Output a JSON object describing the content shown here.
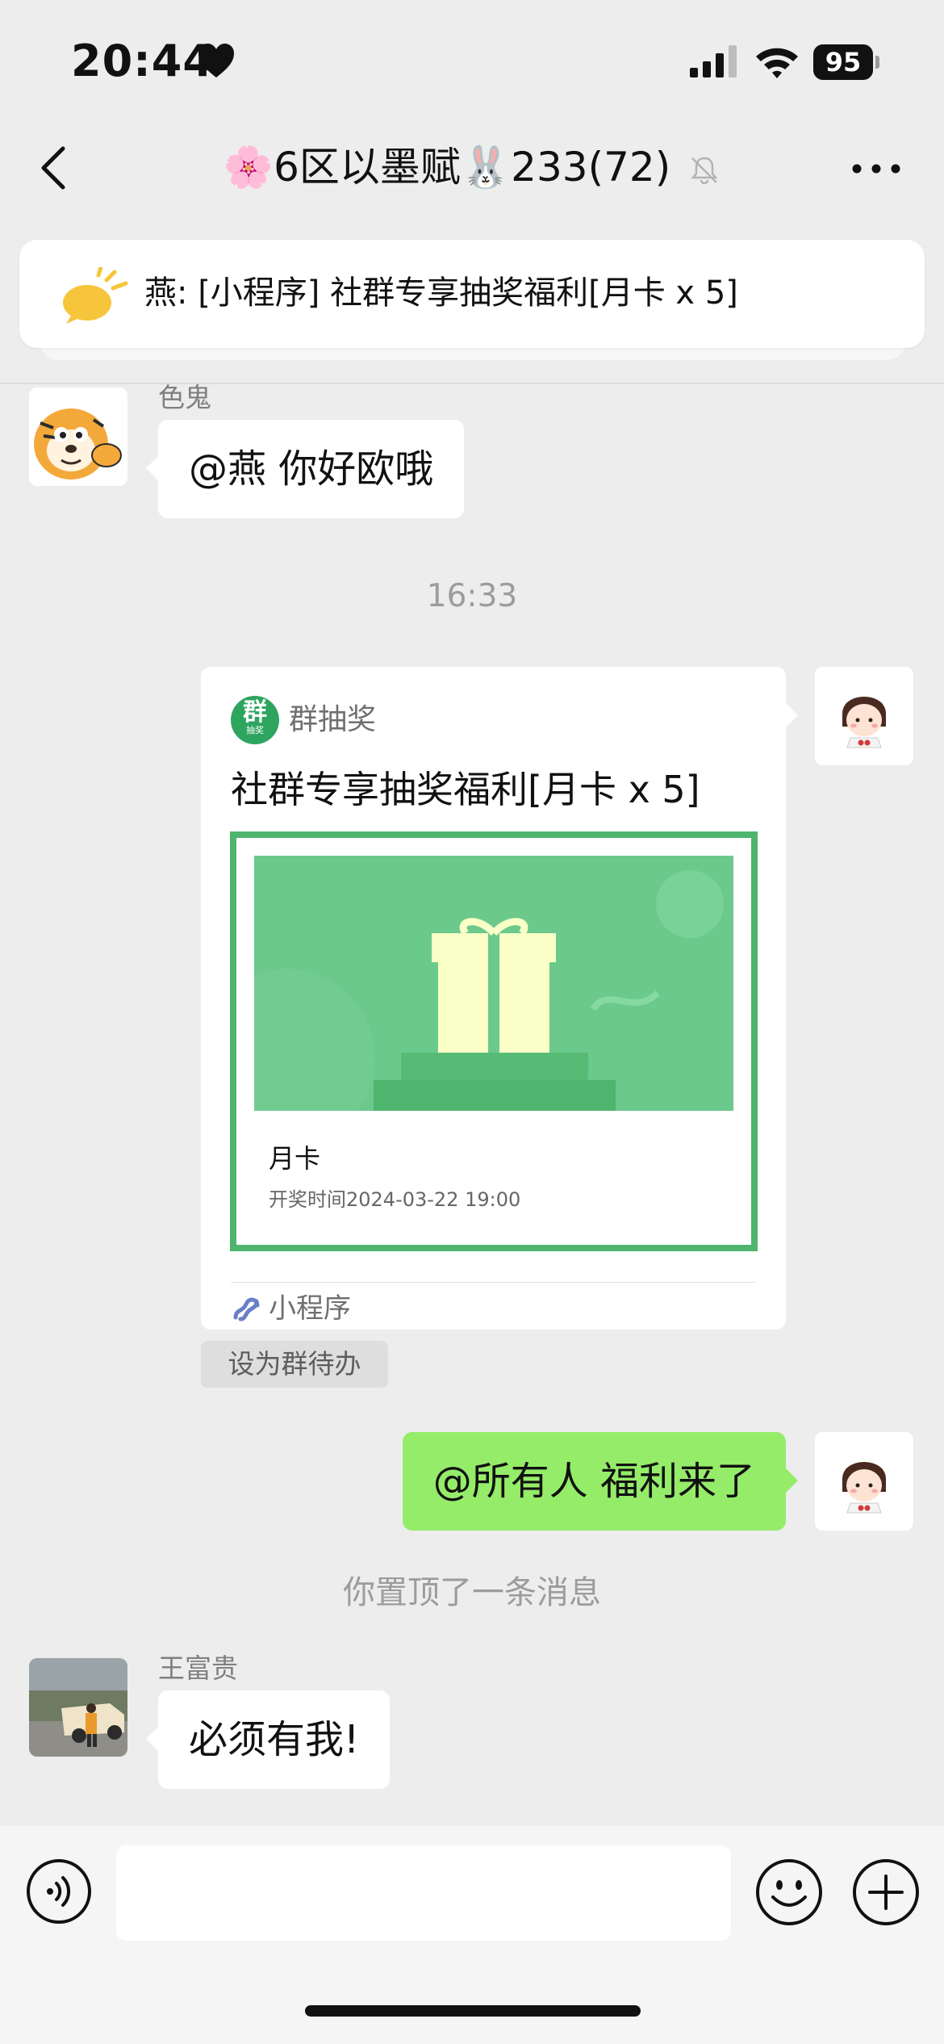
{
  "status_bar": {
    "time": "20:44",
    "battery": "95",
    "icons": [
      "heart-icon",
      "signal-icon",
      "wifi-icon",
      "battery-icon"
    ]
  },
  "nav": {
    "title_emoji_left": "🌸",
    "title": "6区以墨赋",
    "title_emoji_right": "🐰",
    "title_suffix": "233(72)",
    "icons": [
      "back-icon",
      "mute-icon",
      "more-icon"
    ]
  },
  "pinned": {
    "text": "燕: [小程序] 社群专享抽奖福利[月卡 x 5]",
    "icon": "announcement-icon"
  },
  "messages": [
    {
      "sender": "色鬼",
      "text": "@燕 你好欧哦"
    },
    {
      "timestamp": "16:33"
    },
    {
      "mini_program": {
        "app_name": "群抽奖",
        "logo_text": "群",
        "logo_subtext": "抽奖",
        "title": "社群专享抽奖福利[月卡 x 5]",
        "prize": "月卡",
        "draw_time": "开奖时间2024-03-22 19:00",
        "footer": "小程序"
      },
      "action_button": "设为群待办"
    },
    {
      "self_text": "@所有人 福利来了"
    },
    {
      "system_note": "你置顶了一条消息"
    },
    {
      "sender": "王富贵",
      "text": "必须有我!"
    }
  ],
  "input_bar": {
    "icons": [
      "voice-icon",
      "emoji-icon",
      "plus-icon"
    ]
  },
  "colors": {
    "background": "#ededed",
    "self_bubble": "#95ec69",
    "mini_program_green": "#4fb46d"
  }
}
